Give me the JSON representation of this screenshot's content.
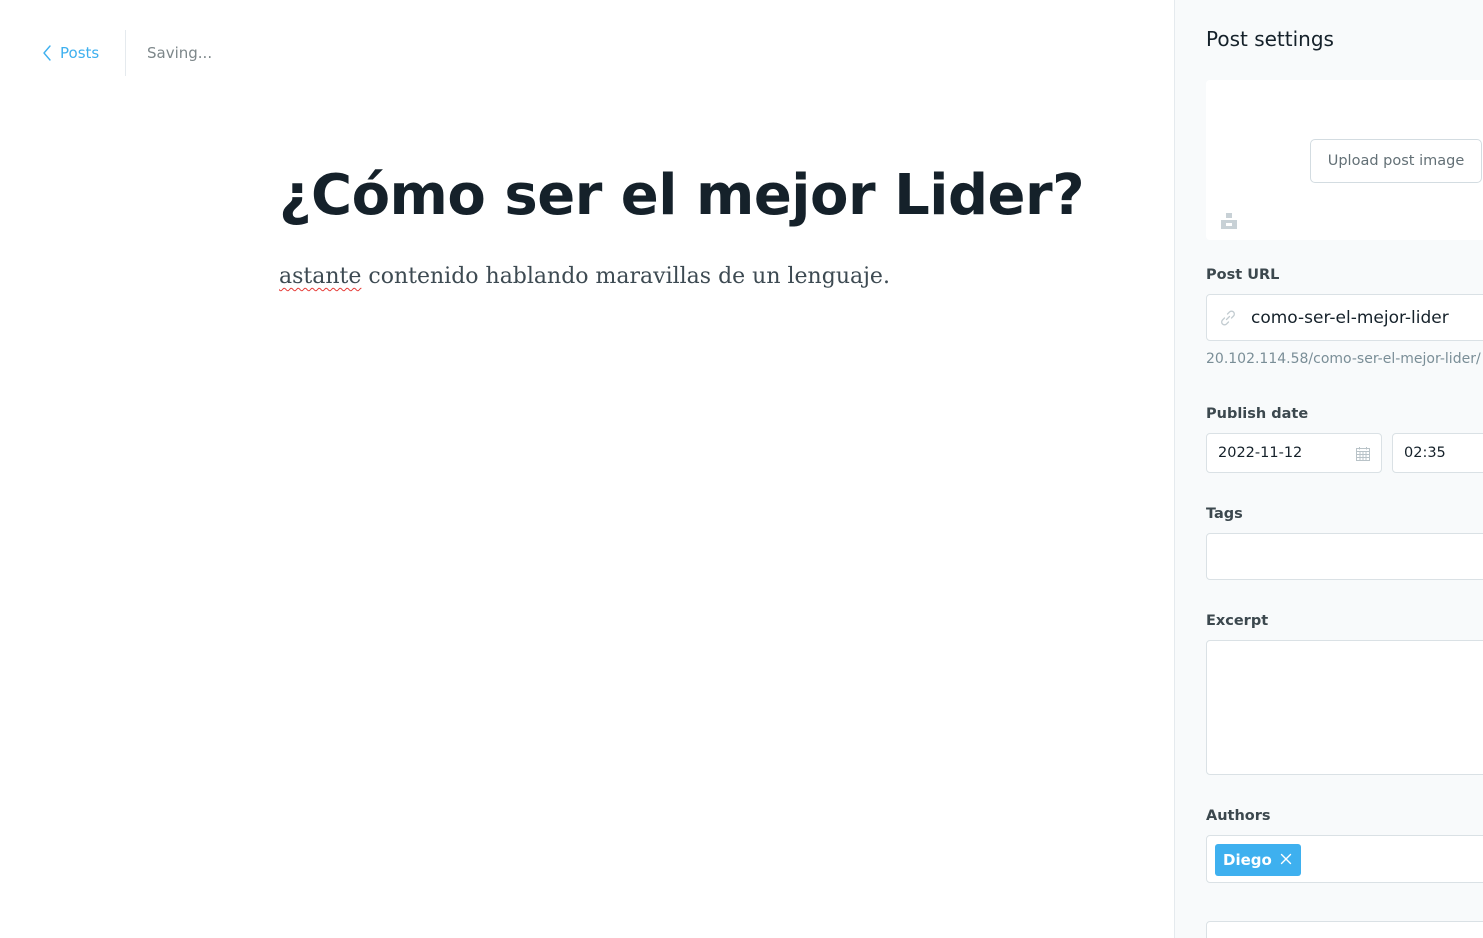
{
  "topbar": {
    "back_label": "Posts",
    "status": "Saving..."
  },
  "post": {
    "title": "¿Cómo ser el mejor Lider?",
    "body_misspelled_word": "astante",
    "body_rest": " contenido hablando maravillas de un lenguaje."
  },
  "settings": {
    "title": "Post settings",
    "upload_image_label": "Upload post image",
    "post_url": {
      "label": "Post URL",
      "value": "como-ser-el-mejor-lider",
      "preview": "20.102.114.58/como-ser-el-mejor-lider/"
    },
    "publish_date": {
      "label": "Publish date",
      "date": "2022-11-12",
      "time": "02:35"
    },
    "tags": {
      "label": "Tags"
    },
    "excerpt": {
      "label": "Excerpt"
    },
    "authors": {
      "label": "Authors",
      "selected": [
        "Diego"
      ]
    }
  },
  "colors": {
    "accent": "#3eb0ef",
    "panel_bg": "#f8fafb",
    "text": "#15212a"
  },
  "icons": [
    "chevron-left-icon",
    "unsplash-icon",
    "link-icon",
    "calendar-icon",
    "close-icon"
  ]
}
